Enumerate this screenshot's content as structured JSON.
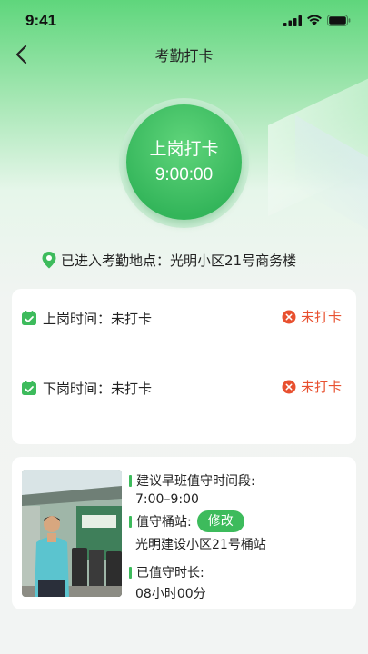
{
  "status_bar": {
    "time": "9:41"
  },
  "header": {
    "title": "考勤打卡"
  },
  "punch": {
    "label": "上岗打卡",
    "time": "9:00:00"
  },
  "location": {
    "text": "已进入考勤地点：光明小区21号商务楼"
  },
  "attendance": {
    "on_duty": {
      "label": "上岗时间：",
      "value": "未打卡",
      "status": "未打卡"
    },
    "off_duty": {
      "label": "下岗时间：",
      "value": "未打卡",
      "status": "未打卡"
    }
  },
  "duty": {
    "suggest_label": "建议早班值守时间段:",
    "suggest_value": "7:00–9:00",
    "station_label": "值守桶站:",
    "edit_label": "修改",
    "station_value": "光明建设小区21号桶站",
    "duration_label": "已值守时长:",
    "duration_value": "08小时00分"
  },
  "colors": {
    "accent": "#3dbb5c",
    "warning": "#e8502f"
  }
}
